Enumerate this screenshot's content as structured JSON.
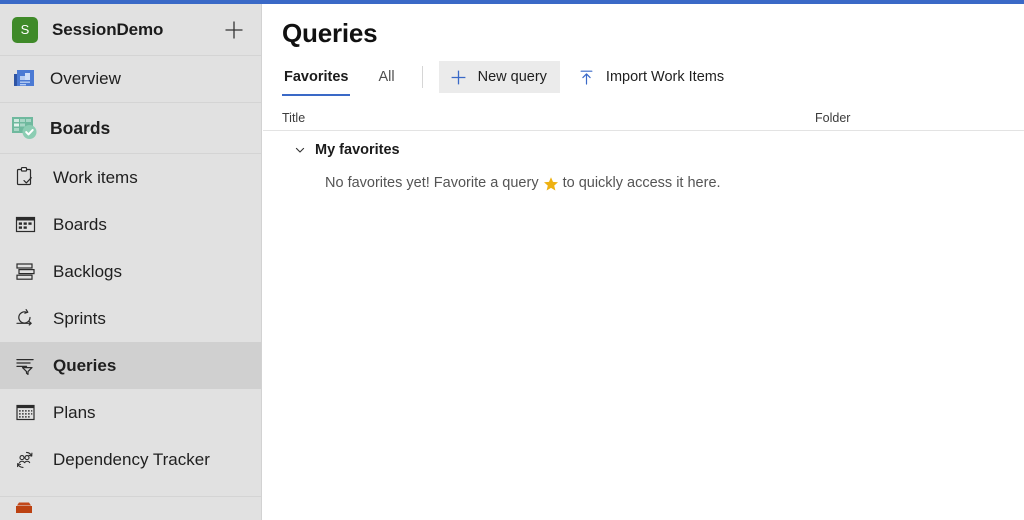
{
  "theme": {
    "accent_blue": "#3a69c7",
    "sidebar_bg": "#e1e1e1",
    "selected_bg": "#d0d0d0",
    "project_avatar_bg": "#3f8a29",
    "star_gold": "#eeb111",
    "boards_icon_teal": "#7cc3a8"
  },
  "sidebar": {
    "project": {
      "avatar_initial": "S",
      "name": "SessionDemo",
      "add_label": "+"
    },
    "overview": {
      "label": "Overview",
      "icon": "overview-icon"
    },
    "section": {
      "label": "Boards",
      "icon": "boards-section-icon"
    },
    "items": [
      {
        "label": "Work items",
        "icon": "clipboard-check-icon",
        "selected": false
      },
      {
        "label": "Boards",
        "icon": "board-grid-icon",
        "selected": false
      },
      {
        "label": "Backlogs",
        "icon": "backlog-stack-icon",
        "selected": false
      },
      {
        "label": "Sprints",
        "icon": "sprint-loop-icon",
        "selected": false
      },
      {
        "label": "Queries",
        "icon": "queries-filter-icon",
        "selected": true
      },
      {
        "label": "Plans",
        "icon": "plans-calendar-icon",
        "selected": false
      },
      {
        "label": "Dependency Tracker",
        "icon": "dependency-people-icon",
        "selected": false
      }
    ]
  },
  "main": {
    "title": "Queries",
    "tabs": [
      {
        "label": "Favorites",
        "active": true
      },
      {
        "label": "All",
        "active": false
      }
    ],
    "buttons": [
      {
        "label": "New query",
        "icon": "plus-icon",
        "filled": true
      },
      {
        "label": "Import Work Items",
        "icon": "upload-icon",
        "filled": false
      }
    ],
    "table": {
      "columns": [
        "Title",
        "Folder"
      ],
      "group": {
        "label": "My favorites",
        "expanded": true
      },
      "empty_state": {
        "text_before": "No favorites yet! Favorite a query",
        "icon": "star-icon",
        "text_after": "to quickly access it here."
      }
    }
  }
}
